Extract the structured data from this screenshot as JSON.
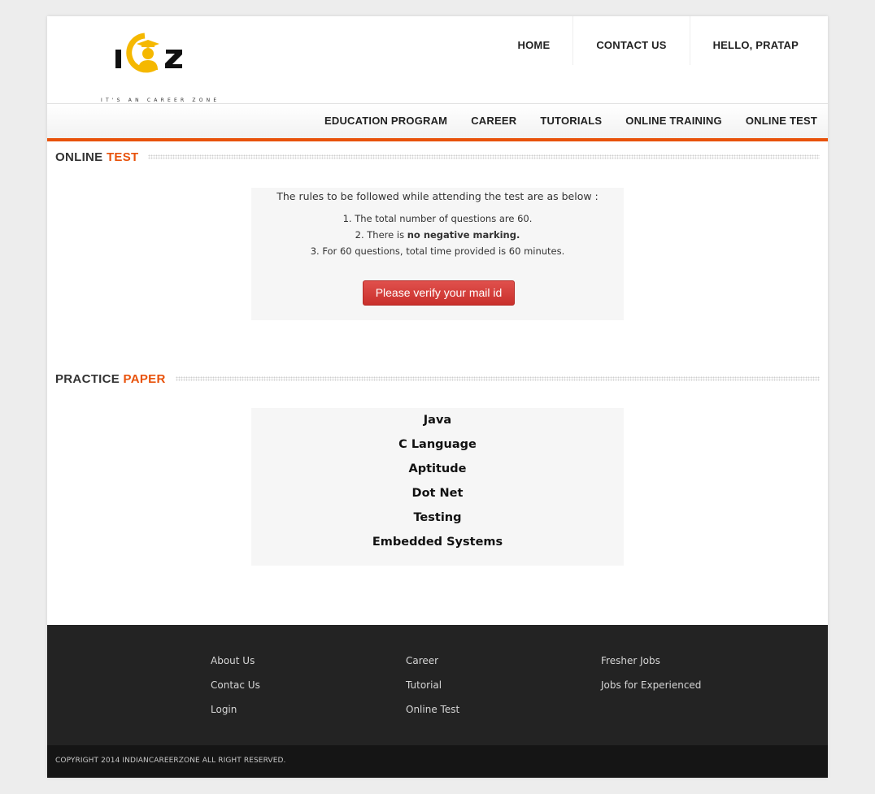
{
  "logo": {
    "letters": "ICZ",
    "tagline": "IT'S AN CAREER ZONE"
  },
  "top_nav": [
    "HOME",
    "CONTACT US",
    "HELLO, PRATAP"
  ],
  "main_nav": [
    "EDUCATION PROGRAM",
    "CAREER",
    "TUTORIALS",
    "ONLINE TRAINING",
    "ONLINE TEST"
  ],
  "online_test": {
    "heading_main": "ONLINE",
    "heading_accent": "TEST",
    "intro": "The rules to be followed while attending the test are as below :",
    "rule1": "1. The total number of questions are 60.",
    "rule2_prefix": "2. There is ",
    "rule2_bold": "no negative marking.",
    "rule3": "3. For 60 questions, total time provided is 60 minutes.",
    "verify_button": "Please verify your mail id"
  },
  "practice_paper": {
    "heading_main": "PRACTICE",
    "heading_accent": "PAPER",
    "papers": [
      "Java",
      "C Language",
      "Aptitude",
      "Dot Net",
      "Testing",
      "Embedded Systems"
    ]
  },
  "footer": {
    "col1": [
      "About Us",
      "Contac Us",
      "Login"
    ],
    "col2": [
      "Career",
      "Tutorial",
      "Online Test"
    ],
    "col3": [
      "Fresher Jobs",
      "Jobs for Experienced"
    ],
    "copyright": "COPYRIGHT 2014 INDIANCAREERZONE ALL RIGHT RESERVED."
  },
  "colors": {
    "accent": "#e8520b",
    "logo_yellow": "#f5b800",
    "button_red": "#d9413d",
    "footer_bg": "#232323",
    "copyright_bg": "#151515"
  }
}
